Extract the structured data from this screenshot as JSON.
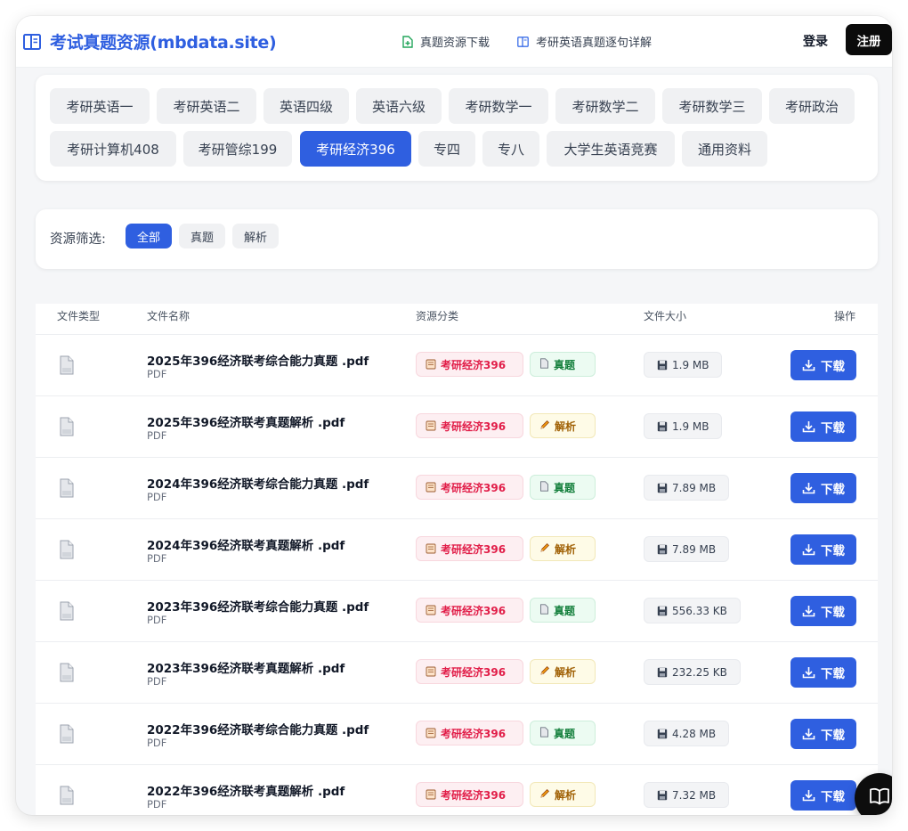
{
  "header": {
    "title": "考试真题资源(mbdata.site)",
    "nav": [
      {
        "label": "真题资源下载",
        "icon": "file-plus-icon"
      },
      {
        "label": "考研英语真题逐句详解",
        "icon": "layout-icon"
      }
    ],
    "login": "登录",
    "register": "注册"
  },
  "categories": [
    {
      "label": "考研英语一",
      "active": false
    },
    {
      "label": "考研英语二",
      "active": false
    },
    {
      "label": "英语四级",
      "active": false
    },
    {
      "label": "英语六级",
      "active": false
    },
    {
      "label": "考研数学一",
      "active": false
    },
    {
      "label": "考研数学二",
      "active": false
    },
    {
      "label": "考研数学三",
      "active": false
    },
    {
      "label": "考研政治",
      "active": false
    },
    {
      "label": "考研计算机408",
      "active": false
    },
    {
      "label": "考研管综199",
      "active": false
    },
    {
      "label": "考研经济396",
      "active": true
    },
    {
      "label": "专四",
      "active": false
    },
    {
      "label": "专八",
      "active": false
    },
    {
      "label": "大学生英语竞赛",
      "active": false
    },
    {
      "label": "通用资料",
      "active": false
    }
  ],
  "filter": {
    "label": "资源筛选:",
    "options": [
      {
        "label": "全部",
        "active": true
      },
      {
        "label": "真题",
        "active": false
      },
      {
        "label": "解析",
        "active": false
      }
    ]
  },
  "table": {
    "headers": [
      "文件类型",
      "文件名称",
      "资源分类",
      "文件大小",
      "操作"
    ],
    "rows": [
      {
        "name": "2025年396经济联考综合能力真题 .pdf",
        "type": "PDF",
        "category": "考研经济396",
        "kind": "真题",
        "size": "1.9 MB",
        "action": "下载"
      },
      {
        "name": "2025年396经济联考真题解析 .pdf",
        "type": "PDF",
        "category": "考研经济396",
        "kind": "解析",
        "size": "1.9 MB",
        "action": "下载"
      },
      {
        "name": "2024年396经济联考综合能力真题 .pdf",
        "type": "PDF",
        "category": "考研经济396",
        "kind": "真题",
        "size": "7.89 MB",
        "action": "下载"
      },
      {
        "name": "2024年396经济联考真题解析 .pdf",
        "type": "PDF",
        "category": "考研经济396",
        "kind": "解析",
        "size": "7.89 MB",
        "action": "下载"
      },
      {
        "name": "2023年396经济联考综合能力真题 .pdf",
        "type": "PDF",
        "category": "考研经济396",
        "kind": "真题",
        "size": "556.33 KB",
        "action": "下载"
      },
      {
        "name": "2023年396经济联考真题解析 .pdf",
        "type": "PDF",
        "category": "考研经济396",
        "kind": "解析",
        "size": "232.25 KB",
        "action": "下载"
      },
      {
        "name": "2022年396经济联考综合能力真题 .pdf",
        "type": "PDF",
        "category": "考研经济396",
        "kind": "真题",
        "size": "4.28 MB",
        "action": "下载"
      },
      {
        "name": "2022年396经济联考真题解析 .pdf",
        "type": "PDF",
        "category": "考研经济396",
        "kind": "解析",
        "size": "7.32 MB",
        "action": "下载"
      }
    ]
  },
  "floating": {
    "icon": "open-book-icon"
  },
  "colors": {
    "accent": "#2f5fe0",
    "dark": "#0b0b0b",
    "tag_red": "#e11d48",
    "tag_green": "#15803d",
    "tag_amber": "#a16207"
  }
}
